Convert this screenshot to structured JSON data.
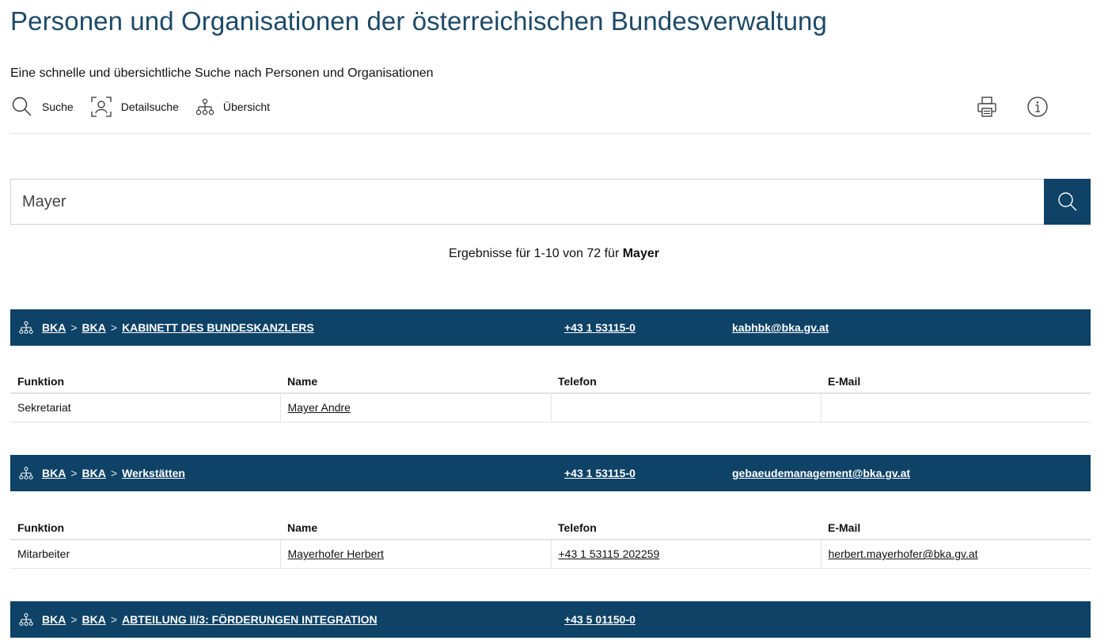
{
  "header": {
    "title": "Personen und Organisationen der österreichischen Bundesverwaltung",
    "subtitle": "Eine schnelle und übersichtliche Suche nach Personen und Organisationen"
  },
  "toolbar": {
    "search_label": "Suche",
    "detail_search_label": "Detailsuche",
    "overview_label": "Übersicht"
  },
  "search": {
    "value": "Mayer",
    "placeholder": ""
  },
  "results": {
    "prefix": "Ergebnisse für 1-10 von 72 für",
    "term": "Mayer"
  },
  "table_headers": {
    "function": "Funktion",
    "name": "Name",
    "phone": "Telefon",
    "email": "E-Mail"
  },
  "colors": {
    "brand": "#0e4266",
    "title": "#1d4a68"
  },
  "groups": [
    {
      "crumb1": "BKA",
      "crumb2": "BKA",
      "org": "KABINETT DES BUNDESKANZLERS",
      "phone": "+43 1 53115-0",
      "email": "kabhbk@bka.gv.at",
      "rows": [
        {
          "function": "Sekretariat",
          "name": "Mayer Andre",
          "phone": "",
          "email": ""
        }
      ]
    },
    {
      "crumb1": "BKA",
      "crumb2": "BKA",
      "org": "Werkstätten",
      "phone": "+43 1 53115-0",
      "email": "gebaeudemanagement@bka.gv.at",
      "rows": [
        {
          "function": "Mitarbeiter",
          "name": "Mayerhofer Herbert",
          "phone": "+43 1 53115 202259",
          "email": "herbert.mayerhofer@bka.gv.at"
        }
      ]
    },
    {
      "crumb1": "BKA",
      "crumb2": "BKA",
      "org": "ABTEILUNG II/3: FÖRDERUNGEN INTEGRATION",
      "phone": "+43 5 01150-0",
      "email": ""
    }
  ]
}
